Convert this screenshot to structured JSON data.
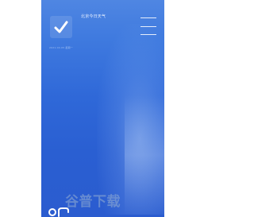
{
  "header": {
    "title": "北京今日天气",
    "subtitle": "2021.04.05 星期一"
  },
  "menu": {
    "icon": "hamburger-menu-icon"
  },
  "logo": {
    "icon": "check-mark-icon"
  },
  "watermark": {
    "text": "谷普下载"
  },
  "colors": {
    "background_top": "#4f86e2",
    "background_bottom": "#2b5ccf",
    "text": "#e9f1ff"
  }
}
